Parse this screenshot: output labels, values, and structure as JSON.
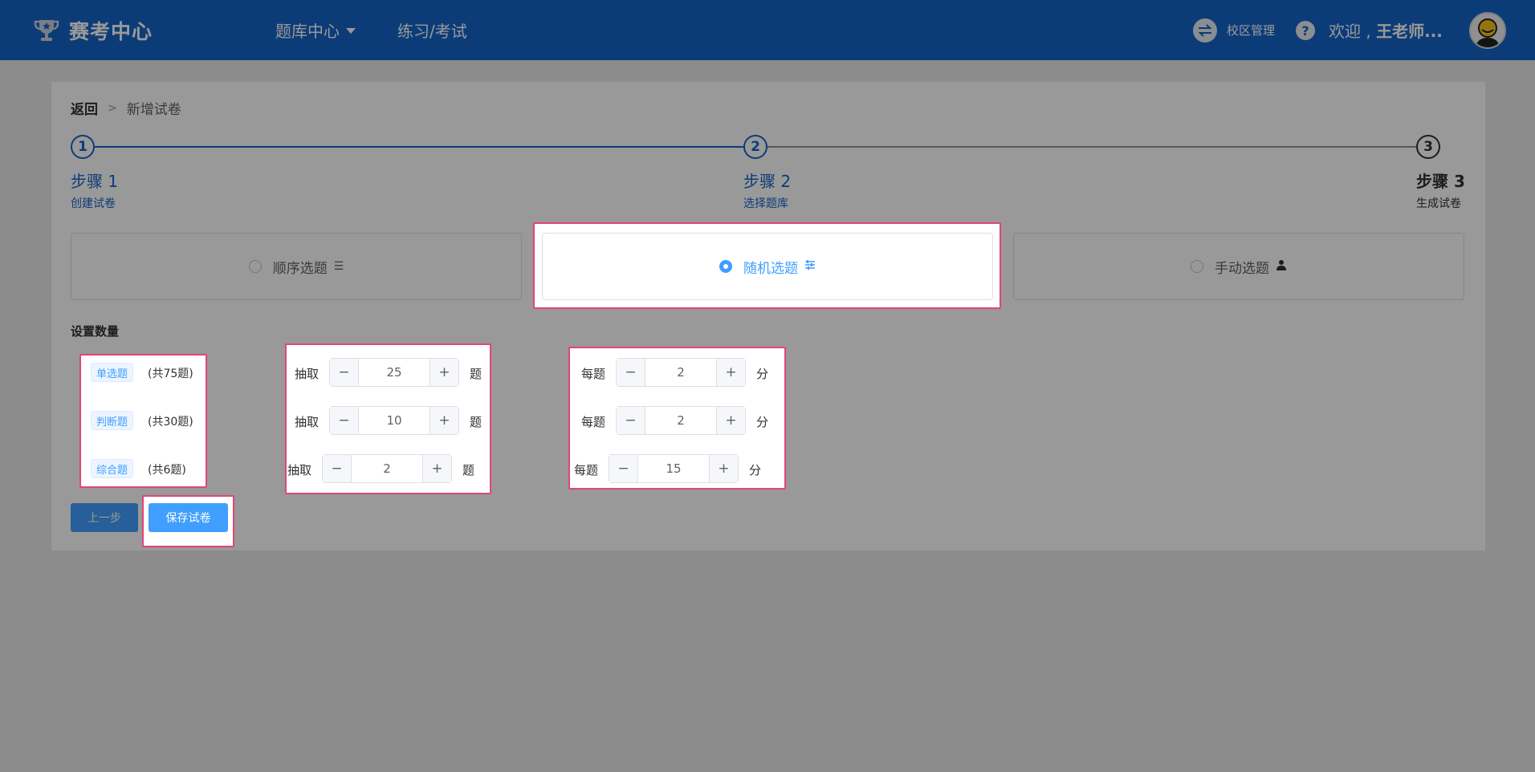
{
  "header": {
    "brand": "赛考中心",
    "nav_bank": "题库中心",
    "nav_practice": "练习/考试",
    "campus": "校区管理",
    "help": "?",
    "welcome_prefix": "欢迎 ,",
    "welcome_user": "王老师...",
    "colors": {
      "bar": "#1565c8"
    }
  },
  "breadcrumb": {
    "back": "返回",
    "current": "新增试卷"
  },
  "steps": [
    {
      "num": "1",
      "title": "步骤 1",
      "desc": "创建试卷"
    },
    {
      "num": "2",
      "title": "步骤 2",
      "desc": "选择题库"
    },
    {
      "num": "3",
      "title": "步骤 3",
      "desc": "生成试卷"
    }
  ],
  "modes": [
    {
      "label": "顺序选题",
      "icon": "list-icon",
      "selected": false
    },
    {
      "label": "随机选题",
      "icon": "sliders-icon",
      "selected": true
    },
    {
      "label": "手动选题",
      "icon": "user-icon",
      "selected": false
    }
  ],
  "section_label": "设置数量",
  "questions": [
    {
      "type": "单选题",
      "total": "(共75题)",
      "draw_label": "抽取",
      "draw": "25",
      "draw_unit": "题",
      "score_label": "每题",
      "score": "2",
      "score_unit": "分"
    },
    {
      "type": "判断题",
      "total": "(共30题)",
      "draw_label": "抽取",
      "draw": "10",
      "draw_unit": "题",
      "score_label": "每题",
      "score": "2",
      "score_unit": "分"
    },
    {
      "type": "综合题",
      "total": "(共6题)",
      "draw_label": "抽取",
      "draw": "2",
      "draw_unit": "题",
      "score_label": "每题",
      "score": "15",
      "score_unit": "分"
    }
  ],
  "stepper_minus": "−",
  "stepper_plus": "+",
  "buttons": {
    "prev": "上一步",
    "save": "保存试卷"
  }
}
